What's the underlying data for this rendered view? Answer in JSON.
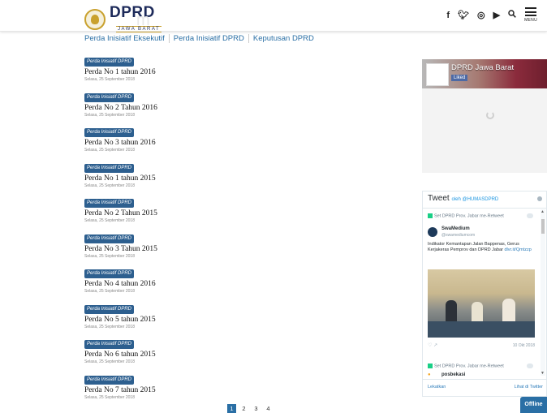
{
  "header": {
    "logo_title": "DPRD",
    "logo_sub": "JAWA BARAT",
    "logo_ghost": "m",
    "menu_label": "MENU"
  },
  "icons": [
    "facebook-icon",
    "twitter-icon",
    "instagram-icon",
    "youtube-icon",
    "search-icon",
    "menu-icon"
  ],
  "tabs": [
    "Perda Inisiatif Eksekutif",
    "Perda Inisiatif DPRD",
    "Keputusan DPRD"
  ],
  "items": [
    {
      "badge": "Perda Inisiatif DPRD",
      "title": "Perda No 1 tahun 2016",
      "date": "Selasa, 25 September 2018"
    },
    {
      "badge": "Perda Inisiatif DPRD",
      "title": "Perda No 2 Tahun 2016",
      "date": "Selasa, 25 September 2018"
    },
    {
      "badge": "Perda Inisiatif DPRD",
      "title": "Perda No 3 tahun 2016",
      "date": "Selasa, 25 September 2018"
    },
    {
      "badge": "Perda Inisiatif DPRD",
      "title": "Perda No 1 tahun 2015",
      "date": "Selasa, 25 September 2018"
    },
    {
      "badge": "Perda Inisiatif DPRD",
      "title": "Perda No 2 Tahun 2015",
      "date": "Selasa, 25 September 2018"
    },
    {
      "badge": "Perda Inisiatif DPRD",
      "title": "Perda No 3 Tahun 2015",
      "date": "Selasa, 25 September 2018"
    },
    {
      "badge": "Perda Inisiatif DPRD",
      "title": "Perda No 4 tahun 2016",
      "date": "Selasa, 25 September 2018"
    },
    {
      "badge": "Perda Inisiatif DPRD",
      "title": "Perda No 5 tahun 2015",
      "date": "Selasa, 25 September 2018"
    },
    {
      "badge": "Perda Inisiatif DPRD",
      "title": "Perda No 6 tahun 2015",
      "date": "Selasa, 25 September 2018"
    },
    {
      "badge": "Perda Inisiatif DPRD",
      "title": "Perda No 7 tahun 2015",
      "date": "Selasa, 25 September 2018"
    }
  ],
  "pagination": [
    "1",
    "2",
    "3",
    "4"
  ],
  "facebook": {
    "page_name": "DPRD Jawa Barat",
    "like_label": "Liked"
  },
  "twitter": {
    "title": "Tweet",
    "by": "oleh @HUMASDPRD",
    "rt_label": "Set DPRD Prov. Jabar me-Retweet",
    "user": "SwaMedium",
    "handle": "@swamediumcom",
    "text": "Indikator Kemantapan Jalan Bappenas, Gerus Kerjakeras Pemprov dan DPRD Jabar",
    "link": "dlvr.it/Qmtzzp",
    "date": "10 Okt 2018",
    "rt_label2": "Set DPRD Prov. Jabar me-Retweet",
    "user2": "posbekasi",
    "embed": "Lekatkan",
    "view": "Lihat di Twitter"
  },
  "offline_label": "Offline",
  "colors": {
    "accent": "#2a6fa5",
    "badge": "#2d5f8f"
  }
}
